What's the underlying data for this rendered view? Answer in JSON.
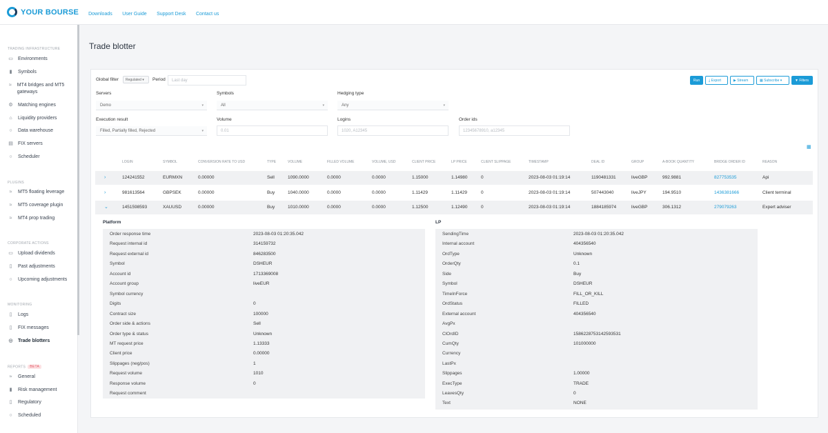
{
  "brand": {
    "name": "YOUR BOURSE"
  },
  "topnav": [
    "Downloads",
    "User Guide",
    "Support Desk",
    "Contact us"
  ],
  "sidebar": {
    "sections": [
      {
        "title": "TRADING INFRASTRUCTURE",
        "items": [
          {
            "label": "Environments",
            "icon": "folder-icon"
          },
          {
            "label": "Symbols",
            "icon": "bar-chart-icon"
          },
          {
            "label": "MT4 bridges and MT5 gateways",
            "icon": "bridge-icon"
          },
          {
            "label": "Matching engines",
            "icon": "matching-icon"
          },
          {
            "label": "Liquidity providers",
            "icon": "bank-icon"
          },
          {
            "label": "Data warehouse",
            "icon": "database-icon"
          },
          {
            "label": "FIX servers",
            "icon": "server-icon"
          },
          {
            "label": "Scheduler",
            "icon": "clock-icon"
          }
        ]
      },
      {
        "title": "PLUGINS",
        "items": [
          {
            "label": "MT5 floating leverage",
            "icon": "plugin-icon"
          },
          {
            "label": "MT5 coverage plugin",
            "icon": "plugin-icon"
          },
          {
            "label": "MT4 prop trading",
            "icon": "plugin-icon"
          }
        ]
      },
      {
        "title": "CORPORATE ACTIONS",
        "items": [
          {
            "label": "Upload dividends",
            "icon": "folder-icon"
          },
          {
            "label": "Past adjustments",
            "icon": "document-icon"
          },
          {
            "label": "Upcoming adjustments",
            "icon": "clock-icon"
          }
        ]
      },
      {
        "title": "MONITORING",
        "items": [
          {
            "label": "Logs",
            "icon": "document-icon"
          },
          {
            "label": "FIX messages",
            "icon": "document-icon"
          },
          {
            "label": "Trade blotters",
            "icon": "globe-icon",
            "active": true
          }
        ]
      },
      {
        "title": "REPORTS",
        "badge": "BETA",
        "items": [
          {
            "label": "General",
            "icon": "plugin-icon"
          },
          {
            "label": "Risk management",
            "icon": "bar-chart-icon"
          },
          {
            "label": "Regulatory",
            "icon": "document-icon"
          },
          {
            "label": "Scheduled",
            "icon": "clock-icon"
          }
        ]
      }
    ]
  },
  "page": {
    "title": "Trade blotter"
  },
  "filters": {
    "global_filter_label": "Global filter",
    "global_filter_value": "Regulated",
    "period_label": "Period",
    "period_placeholder": "Last day",
    "servers_label": "Servers",
    "servers_value": "Demo",
    "symbols_label": "Symbols",
    "symbols_value": "All",
    "hedging_label": "Hedging type",
    "hedging_value": "Any",
    "exec_label": "Execution result",
    "exec_value": "Filled, Partially filled, Rejected",
    "volume_label": "Volume",
    "volume_placeholder": "0.01",
    "logins_label": "Logins",
    "logins_placeholder": "1020, A12345",
    "orderids_label": "Order ids",
    "orderids_placeholder": "12345678910, a12345"
  },
  "actions": {
    "run": "Run",
    "export": "Export",
    "stream": "Stream",
    "subscribe": "Subscribe",
    "filters": "Filters"
  },
  "table": {
    "columns": [
      "LOGIN",
      "SYMBOL",
      "CONVERSION RATE TO USD",
      "TYPE",
      "VOLUME",
      "FILLED VOLUME",
      "VOLUME, USD",
      "CLIENT PRICE",
      "LP PRICE",
      "CLIENT SLIPPAGE",
      "TIMESTAMP",
      "DEAL ID",
      "GROUP",
      "A-BOOK QUANTITY",
      "BRIDGE ORDER ID",
      "REASON"
    ],
    "rows": [
      [
        "124241552",
        "EURMXN",
        "0.00000",
        "Sell",
        "1090.0000",
        "0.0000",
        "0.0000",
        "1.15000",
        "1.14980",
        "0",
        "2023-08-03 01:19:14",
        "1190481331",
        "liveGBP",
        "992.9881",
        "827753535",
        "Api"
      ],
      [
        "981613564",
        "GBPSEK",
        "0.00000",
        "Buy",
        "1040.0000",
        "0.0000",
        "0.0000",
        "1.11429",
        "1.11429",
        "0",
        "2023-08-03 01:19:14",
        "507443040",
        "liveJPY",
        "194.9510",
        "1436381666",
        "Client terminal"
      ],
      [
        "1451598593",
        "XAUUSD",
        "0.00000",
        "Buy",
        "1010.0000",
        "0.0000",
        "0.0000",
        "1.12500",
        "1.12490",
        "0",
        "2023-08-03 01:19:14",
        "1884185974",
        "liveGBP",
        "306.1312",
        "279079263",
        "Expert adviser"
      ]
    ]
  },
  "details": {
    "platform_title": "Platform",
    "platform": [
      [
        "Order response time",
        "2023-08-03 01:20:35.042"
      ],
      [
        "Request internal id",
        "314159732"
      ],
      [
        "Request external id",
        "846283500"
      ],
      [
        "Symbol",
        "DSHEUR"
      ],
      [
        "Account id",
        "1713369008"
      ],
      [
        "Account group",
        "liveEUR"
      ],
      [
        "Symbol currency",
        ""
      ],
      [
        "Digits",
        "0"
      ],
      [
        "Contract size",
        "100000"
      ],
      [
        "Order side & actions",
        "Sell"
      ],
      [
        "Order type & status",
        "Unknown"
      ],
      [
        "MT request price",
        "1.13333"
      ],
      [
        "Client price",
        "0.00000"
      ],
      [
        "Slippages (neg/pos)",
        "1"
      ],
      [
        "Request volume",
        "1010"
      ],
      [
        "Response volume",
        "0"
      ],
      [
        "Request comment",
        ""
      ]
    ],
    "lp_title": "LP",
    "lp": [
      [
        "SendingTime",
        "2023-08-03 01:20:35.042"
      ],
      [
        "Internal account",
        "404356540"
      ],
      [
        "OrdType",
        "Unknown"
      ],
      [
        "OrderQty",
        "0.1"
      ],
      [
        "Side",
        "Buy"
      ],
      [
        "Symbol",
        "DSHEUR"
      ],
      [
        "TimeInForce",
        "FILL_OR_KILL"
      ],
      [
        "OrdStatus",
        "FILLED"
      ],
      [
        "External account",
        "404356540"
      ],
      [
        "AvgPx",
        ""
      ],
      [
        "ClOrdID",
        "1586228753142593531"
      ],
      [
        "CumQty",
        "101000000"
      ],
      [
        "Currency",
        ""
      ],
      [
        "LastPx",
        ""
      ],
      [
        "Slippages",
        "1.00000"
      ],
      [
        "ExecType",
        "TRADE"
      ],
      [
        "LeavesQty",
        "0"
      ],
      [
        "Text",
        "NONE"
      ]
    ]
  }
}
